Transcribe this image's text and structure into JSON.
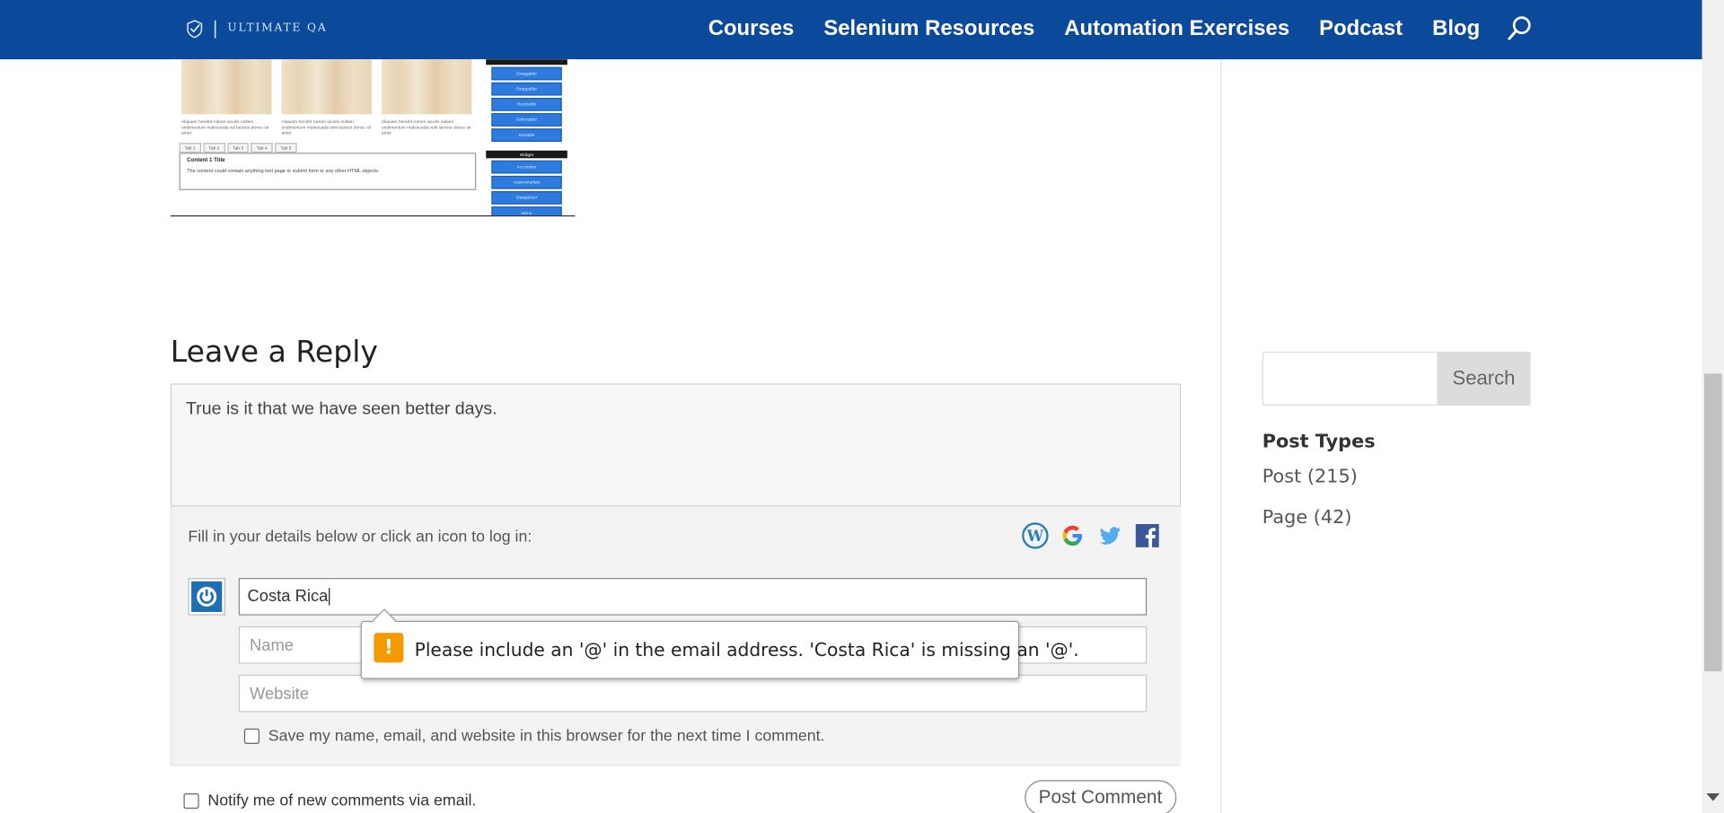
{
  "header": {
    "logo_text": "ULTIMATE QA",
    "logo_separator": "|",
    "nav": [
      "Courses",
      "Selenium Resources",
      "Automation Exercises",
      "Podcast",
      "Blog"
    ],
    "search_icon": "search-icon",
    "bg_color": "#0b4a9a"
  },
  "thumbnail": {
    "captions": [
      "Aliquam hendrit rutrum iaculis nullam ondimentum malesuada vel laoreet donec sit amet",
      "Aliquam hendrit rutrum iaculis nullam ondimentum malesuada velit laoreet donec sit amet",
      "Aliquam hendrit rutrum iaculis nullam ondimentum malesuada velit laoreet donec sit amet"
    ],
    "tabs": [
      "Tab 1",
      "Tab 2",
      "Tab 3",
      "Tab 4",
      "Tab 5"
    ],
    "content_title": "Content 1 Title",
    "content_text": "The content could contain anything text page or submit form or any other HTML objects.",
    "button_group_1": [
      "Draggable",
      "Droppable",
      "Resizable",
      "Selectable",
      "Sortable"
    ],
    "widget_header": "Widget",
    "button_group_2": [
      "Accordion",
      "Autocomplete",
      "Datepicker",
      "Menu"
    ]
  },
  "reply": {
    "title": "Leave a Reply",
    "comment_text": "True is it that we have seen better days.",
    "fill_text": "Fill in your details below or click an icon to log in:",
    "login_icons": [
      "wordpress-icon",
      "google-icon",
      "twitter-icon",
      "facebook-icon"
    ],
    "email_value": "Costa Rica",
    "name_placeholder": "Name",
    "website_placeholder": "Website",
    "save_label": "Save my name, email, and website in this browser for the next time I comment.",
    "notify_label": "Notify me of new comments via email.",
    "post_button": "Post Comment"
  },
  "validation": {
    "icon": "!",
    "message": "Please include an '@' in the email address. 'Costa Rica' is missing an '@'.",
    "icon_color": "#f59b00"
  },
  "sidebar": {
    "search_button": "Search",
    "post_types_title": "Post Types",
    "links": [
      "Post (215)",
      "Page (42)"
    ]
  }
}
